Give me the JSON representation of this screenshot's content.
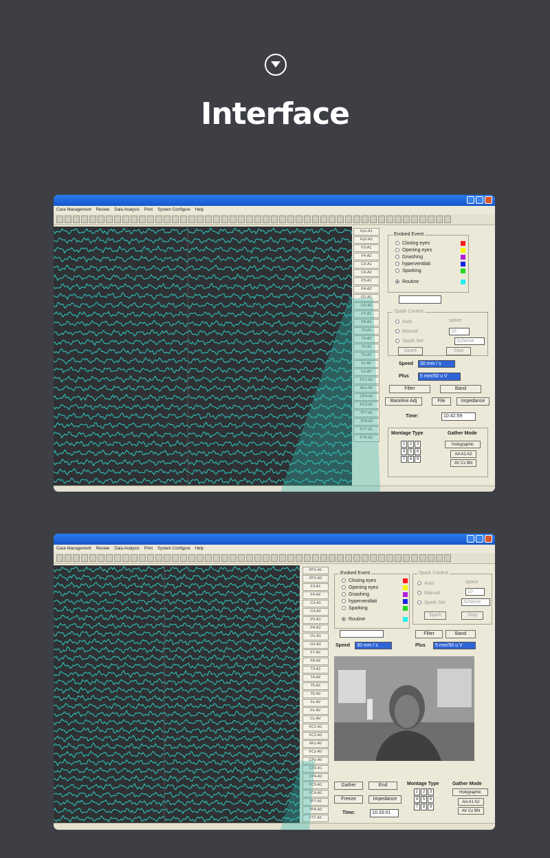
{
  "page": {
    "title": "Interface",
    "icon": "chevron-down-circle-icon"
  },
  "app": {
    "menu": [
      "Case Management",
      "Review",
      "Data Analysis",
      "Print",
      "System Configure",
      "Help"
    ],
    "colors": {
      "trace": "#2fb8b0",
      "trace_bg": "#2f3134",
      "titlebar": "#1c62d8"
    }
  },
  "shot1": {
    "channels": [
      "Fp1-A1",
      "Fp2-A2",
      "F3-A1",
      "F4-A2",
      "C3-A1",
      "C4-A2",
      "P3-A1",
      "P4-A2",
      "O1-A1",
      "O2-A2",
      "F7-A1",
      "F8-A2",
      "T3-A1",
      "T4-A2",
      "T5-A1",
      "T6-A2",
      "Fz-AV",
      "Cz-AV",
      "FC1-A1",
      "AFz-AV",
      "CP4-A2",
      "FC3-A1",
      "TP7-A1",
      "TP8-A2",
      "FT7-A1",
      "FT8-A2"
    ],
    "evoked": {
      "title": "Evoked Event",
      "items": [
        {
          "label": "Closing eyes",
          "color": "#ff1a1a"
        },
        {
          "label": "Opening eyes",
          "color": "#f5f500"
        },
        {
          "label": "Gnashing",
          "color": "#b11cd8"
        },
        {
          "label": "hyperventilati",
          "color": "#1a22e8"
        },
        {
          "label": "Sparking",
          "color": "#22d822"
        },
        {
          "label": "Routine",
          "color": "#22f0f0"
        }
      ]
    },
    "spark": {
      "title": "Spark Control",
      "auto": "Auto",
      "manual": "Manual",
      "spark_set": "Spark Set",
      "space": "space",
      "space_value": "10",
      "scheme": "Scheme",
      "spark_btn": "Spark",
      "stop_btn": "Stop"
    },
    "speed_label": "Speed",
    "speed_value": "30 mm / s",
    "plus_label": "Plus",
    "plus_value": "5 mm/50 u V",
    "filter": "Filter",
    "band": "Band",
    "baseline": "Baseline Adj",
    "file": "File",
    "impedance": "Impedance",
    "time_label": "Time:",
    "time_value": "10:42:59",
    "montage_title": "Montage Type",
    "gather_title": "Gather Mode",
    "montage_grid": [
      "1",
      "2",
      "3",
      "4",
      "5",
      "6",
      "7",
      "8",
      "9"
    ],
    "gather_holo": "Holographic",
    "gather_row1": "AA A1 A2",
    "gather_row2": "AV Cz BN"
  },
  "shot2": {
    "channels": [
      "FP1-A1",
      "FP2-A2",
      "F3-A1",
      "F4-A2",
      "C3-A1",
      "C4-A2",
      "P3-A1",
      "P4-A2",
      "O1-A1",
      "O2-A2",
      "F7-A1",
      "F8-A2",
      "T3-A1",
      "T4-A2",
      "T5-A1",
      "T6-A2",
      "Fz-AV",
      "Pz-AV",
      "Cz-AV",
      "FC1-A1",
      "FC2-A2",
      "AFz-AV",
      "FCz-AV",
      "CPz-AV",
      "CP3-A1",
      "CP4-A2",
      "FC3-A1",
      "FC4-A2",
      "TP7-A1",
      "TP8-A2",
      "FT7-A1",
      "FT8-A2"
    ],
    "evoked": {
      "title": "Evoked Event",
      "items": [
        {
          "label": "Closing eyes",
          "color": "#ff1a1a"
        },
        {
          "label": "Opening eyes",
          "color": "#f5f500"
        },
        {
          "label": "Gnashing",
          "color": "#b11cd8"
        },
        {
          "label": "hyperventilati",
          "color": "#1a22e8"
        },
        {
          "label": "Sparking",
          "color": "#22d822"
        },
        {
          "label": "Routine",
          "color": "#22f0f0"
        }
      ]
    },
    "spark": {
      "title": "Spark Control",
      "auto": "Auto",
      "manual": "Manual",
      "spark_set": "Spark Set",
      "space": "space",
      "space_value": "10",
      "scheme": "Scheme",
      "spark_btn": "Spark",
      "stop_btn": "Stop"
    },
    "speed_label": "Speed",
    "speed_value": "30 mm / s",
    "plus_label": "Plus",
    "plus_value": "5 mm/50 u V",
    "filter": "Filter",
    "band": "Band",
    "gather": "Gather",
    "end": "End",
    "freeze": "Freeze",
    "impedance": "Impedance",
    "time_label": "Time:",
    "time_value": "10:33:01",
    "montage_title": "Montage Type",
    "gather_title": "Gather Mode",
    "montage_grid": [
      "1",
      "2",
      "3",
      "4",
      "5",
      "6",
      "7",
      "8",
      "9"
    ],
    "gather_holo": "Holographic",
    "gather_row1": "AA A1 A2",
    "gather_row2": "AV Cz BN"
  }
}
